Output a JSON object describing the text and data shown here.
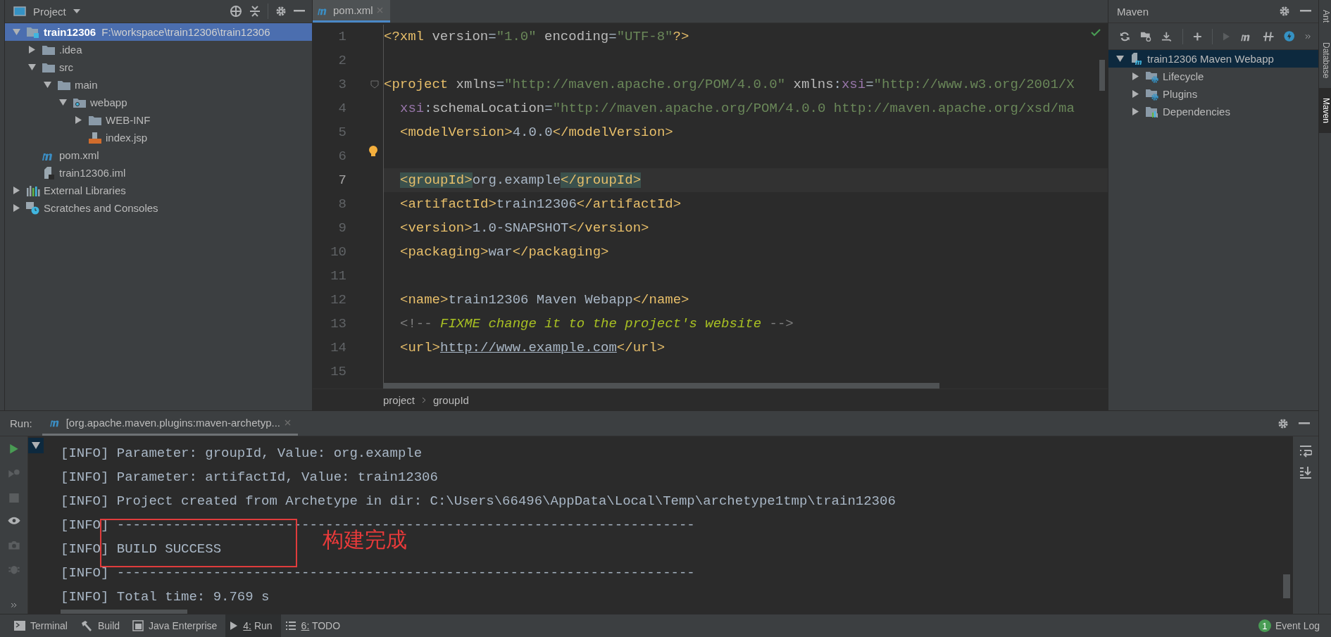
{
  "project": {
    "title": "Project",
    "focused": true,
    "tree": [
      {
        "kind": "module",
        "name": "train12306",
        "path": "F:\\workspace\\train12306\\train12306",
        "selected": true,
        "expanded": true,
        "children": [
          {
            "kind": "folder",
            "name": ".idea",
            "selected": false,
            "expanded": false
          },
          {
            "kind": "folder",
            "name": "src",
            "selected": false,
            "expanded": true,
            "children": [
              {
                "kind": "folder",
                "name": "main",
                "selected": false,
                "expanded": true,
                "children": [
                  {
                    "kind": "webfolder",
                    "name": "webapp",
                    "selected": false,
                    "expanded": true,
                    "children": [
                      {
                        "kind": "folder",
                        "name": "WEB-INF",
                        "selected": false,
                        "expanded": false
                      },
                      {
                        "kind": "jsp",
                        "name": "index.jsp",
                        "selected": false
                      }
                    ]
                  }
                ]
              }
            ]
          },
          {
            "kind": "maven",
            "name": "pom.xml",
            "selected": false
          },
          {
            "kind": "iml",
            "name": "train12306.iml",
            "selected": false
          }
        ]
      },
      {
        "kind": "libraries",
        "name": "External Libraries",
        "selected": false,
        "expanded": false
      },
      {
        "kind": "scratches",
        "name": "Scratches and Consoles",
        "selected": false,
        "expanded": false
      }
    ]
  },
  "editor": {
    "tabs": [
      {
        "label": "pom.xml",
        "selected": true
      }
    ],
    "lines": [
      {
        "number": "1",
        "current": false,
        "nested": false,
        "tokens": [
          {
            "kind": "tag",
            "text": "<?xml"
          },
          {
            "kind": "attr",
            "text": " version"
          },
          {
            "kind": "text",
            "text": "="
          },
          {
            "kind": "str",
            "text": "\"1.0\""
          },
          {
            "kind": "attr",
            "text": " encoding"
          },
          {
            "kind": "text",
            "text": "="
          },
          {
            "kind": "str",
            "text": "\"UTF-8\""
          },
          {
            "kind": "tag",
            "text": "?>"
          }
        ]
      },
      {
        "number": "2",
        "current": false
      },
      {
        "number": "3",
        "current": false,
        "nested": false,
        "fold": true,
        "tokens": [
          {
            "kind": "tag",
            "text": "<project"
          },
          {
            "kind": "attr",
            "text": " xmlns"
          },
          {
            "kind": "text",
            "text": "="
          },
          {
            "kind": "str",
            "text": "\"http://maven.apache.org/POM/4.0.0\""
          },
          {
            "kind": "attr",
            "text": " xmlns"
          },
          {
            "kind": "text",
            "text": ":"
          },
          {
            "kind": "ns",
            "text": "xsi"
          },
          {
            "kind": "text",
            "text": "="
          },
          {
            "kind": "str",
            "text": "\"http://www.w3.org/2001/X"
          }
        ]
      },
      {
        "number": "4",
        "current": false,
        "nested": true,
        "tokens": [
          {
            "kind": "ns",
            "text": "xsi"
          },
          {
            "kind": "text",
            "text": ":"
          },
          {
            "kind": "attr",
            "text": "schemaLocation"
          },
          {
            "kind": "text",
            "text": "="
          },
          {
            "kind": "str",
            "text": "\"http://maven.apache.org/POM/4.0.0 http://maven.apache.org/xsd/ma"
          }
        ]
      },
      {
        "number": "5",
        "current": false,
        "nested": true,
        "tokens": [
          {
            "kind": "tag",
            "text": "<modelVersion>"
          },
          {
            "kind": "text",
            "text": "4.0.0"
          },
          {
            "kind": "tag",
            "text": "</modelVersion>"
          }
        ]
      },
      {
        "number": "6",
        "current": false,
        "bulb": true
      },
      {
        "number": "7",
        "current": true,
        "nested": true,
        "tokens": [
          {
            "kind": "match",
            "text": "<groupId>"
          },
          {
            "kind": "text",
            "text": "org.example"
          },
          {
            "kind": "match",
            "text": "</groupId>"
          }
        ]
      },
      {
        "number": "8",
        "current": false,
        "nested": true,
        "tokens": [
          {
            "kind": "tag",
            "text": "<artifactId>"
          },
          {
            "kind": "text",
            "text": "train12306"
          },
          {
            "kind": "tag",
            "text": "</artifactId>"
          }
        ]
      },
      {
        "number": "9",
        "current": false,
        "nested": true,
        "tokens": [
          {
            "kind": "tag",
            "text": "<version>"
          },
          {
            "kind": "text",
            "text": "1.0-SNAPSHOT"
          },
          {
            "kind": "tag",
            "text": "</version>"
          }
        ]
      },
      {
        "number": "10",
        "current": false,
        "nested": true,
        "tokens": [
          {
            "kind": "tag",
            "text": "<packaging>"
          },
          {
            "kind": "text",
            "text": "war"
          },
          {
            "kind": "tag",
            "text": "</packaging>"
          }
        ]
      },
      {
        "number": "11",
        "current": false
      },
      {
        "number": "12",
        "current": false,
        "nested": true,
        "tokens": [
          {
            "kind": "tag",
            "text": "<name>"
          },
          {
            "kind": "text",
            "text": "train12306 Maven Webapp"
          },
          {
            "kind": "tag",
            "text": "</name>"
          }
        ]
      },
      {
        "number": "13",
        "current": false,
        "nested": true,
        "tokens": [
          {
            "kind": "comment",
            "text": "<!--"
          },
          {
            "kind": "todo",
            "text": " FIXME change it to the project's website"
          },
          {
            "kind": "comment",
            "text": " -->"
          }
        ]
      },
      {
        "number": "14",
        "current": false,
        "nested": true,
        "tokens": [
          {
            "kind": "tag",
            "text": "<url>"
          },
          {
            "kind": "link",
            "text": "http://www.example.com"
          },
          {
            "kind": "tag",
            "text": "</url>"
          }
        ]
      },
      {
        "number": "15",
        "current": false
      }
    ],
    "breadcrumbs": [
      "project",
      "groupId"
    ]
  },
  "maven": {
    "title": "Maven",
    "focused": false,
    "tree": [
      {
        "kind": "maven-project",
        "name": "train12306 Maven Webapp",
        "selected": true,
        "expanded": true,
        "children": [
          {
            "kind": "lifecycle",
            "name": "Lifecycle",
            "selected": false,
            "expanded": false
          },
          {
            "kind": "plugins",
            "name": "Plugins",
            "selected": false,
            "expanded": false
          },
          {
            "kind": "dependencies",
            "name": "Dependencies",
            "selected": false,
            "expanded": false
          }
        ]
      }
    ]
  },
  "side_tabs": [
    {
      "label": "Ant",
      "selected": false
    },
    {
      "label": "Database",
      "selected": false
    },
    {
      "label": "Maven",
      "selected": true
    }
  ],
  "run": {
    "label": "Run:",
    "tab": "[org.apache.maven.plugins:maven-archetyp...",
    "console": [
      "[INFO] Parameter: groupId, Value: org.example",
      "[INFO] Parameter: artifactId, Value: train12306",
      "[INFO] Project created from Archetype in dir: C:\\Users\\66496\\AppData\\Local\\Temp\\archetype1tmp\\train12306",
      "[INFO] ------------------------------------------------------------------------",
      "[INFO] BUILD SUCCESS",
      "[INFO] ------------------------------------------------------------------------",
      "[INFO] Total time: 9.769 s"
    ],
    "annotation": "构建完成"
  },
  "tool_tabs": [
    {
      "kind": "terminal",
      "label": "Terminal",
      "mnemonic": false,
      "selected": false
    },
    {
      "kind": "build",
      "label": "Build",
      "mnemonic": false,
      "selected": false
    },
    {
      "kind": "enterprise",
      "label": "Java Enterprise",
      "mnemonic": false,
      "selected": false
    },
    {
      "kind": "run",
      "label": "4: Run",
      "mnemonic": true,
      "selected": true
    },
    {
      "kind": "todo",
      "label": "6: TODO",
      "mnemonic": true,
      "selected": false
    }
  ],
  "event_log": {
    "count": "1",
    "label": "Event Log"
  }
}
